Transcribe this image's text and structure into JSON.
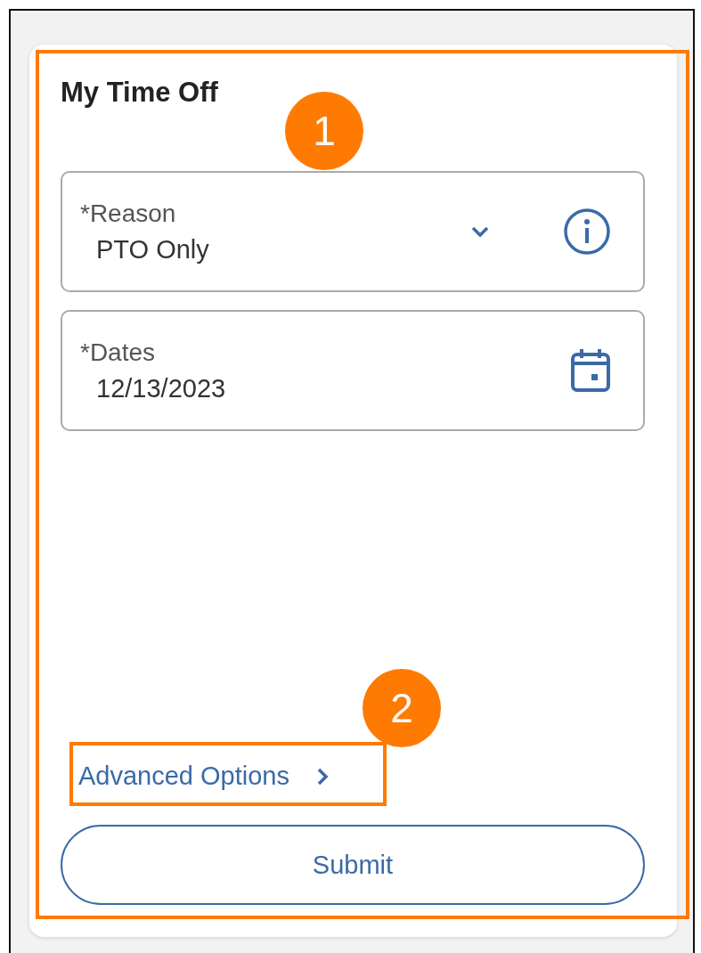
{
  "card": {
    "title": "My Time Off",
    "fields": [
      {
        "kind": "select",
        "label": "*Reason",
        "value": "PTO Only"
      },
      {
        "kind": "date",
        "label": "*Dates",
        "value": "12/13/2023"
      }
    ],
    "advanced_link": "Advanced Options",
    "submit": "Submit"
  },
  "annotations": [
    {
      "label": "1"
    },
    {
      "label": "2"
    }
  ]
}
